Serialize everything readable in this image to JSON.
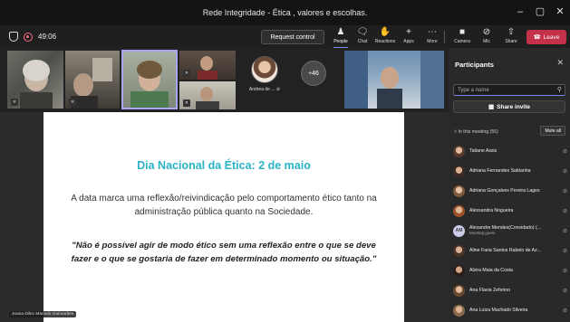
{
  "window": {
    "title": "Rede Integridade - Ética , valores e escolhas.",
    "controls": [
      "–",
      "▢",
      "✕"
    ]
  },
  "toolbar": {
    "timer": "49:06",
    "request_control": "Request control",
    "people": "People",
    "chat": "Chat",
    "reactions": "Reactions",
    "apps": "Apps",
    "more": "More",
    "camera": "Camera",
    "mic": "Mic",
    "share": "Share",
    "leave": "Leave"
  },
  "gallery": {
    "named_participant": "Andrea de ...",
    "overflow_count": "+46"
  },
  "slide": {
    "title": "Dia Nacional da Ética: 2 de maio",
    "body": "A data marca uma reflexão/reivindicação pelo comportamento ético tanto na administração pública quanto na Sociedade.",
    "quote": "\"Não é possível agir de modo ético sem uma reflexão entre o que se deve fazer e o que se gostaria de fazer em determinado momento ou situação.\"",
    "presenter_label": "Joana Dilec Macedo Guimarães"
  },
  "participants": {
    "title": "Participants",
    "search_placeholder": "Type a name",
    "share_invite": "Share invite",
    "section_label": "In this meeting (55)",
    "mute_all": "Mute all",
    "list": [
      {
        "name": "Tatiane Assis",
        "sub": ""
      },
      {
        "name": "Adriana Fernandes Saldanha",
        "sub": ""
      },
      {
        "name": "Adriana Gonçalves Pereira Lages",
        "sub": ""
      },
      {
        "name": "Alessandra Nogueira",
        "sub": ""
      },
      {
        "name": "Alexandre Mendes(Convidado) (...",
        "sub": "Meeting guest",
        "initials": "AM"
      },
      {
        "name": "Aline Faria Santos Rabelo de Az...",
        "sub": ""
      },
      {
        "name": "Alzira Maia da Costa",
        "sub": ""
      },
      {
        "name": "Ana Flavia Zeferino",
        "sub": ""
      },
      {
        "name": "Ana Luiza Machado Silveira",
        "sub": ""
      }
    ]
  },
  "colors": {
    "accent": "#7f85f5",
    "leave": "#c4314b",
    "slide_title": "#2ab3c6"
  }
}
